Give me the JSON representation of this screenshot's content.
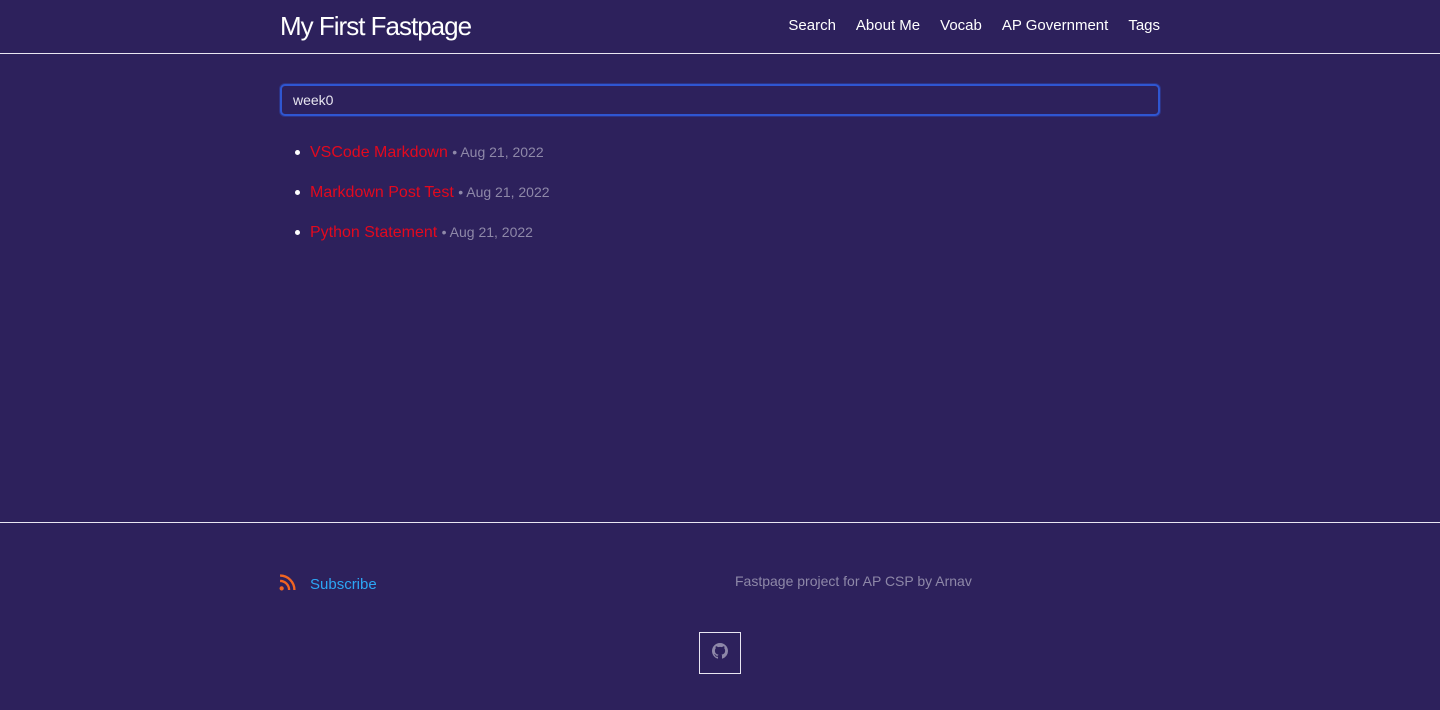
{
  "header": {
    "site_title": "My First Fastpage",
    "nav": [
      {
        "label": "Search"
      },
      {
        "label": "About Me"
      },
      {
        "label": "Vocab"
      },
      {
        "label": "AP Government"
      },
      {
        "label": "Tags"
      }
    ]
  },
  "search": {
    "value": "week0"
  },
  "results": [
    {
      "title": "VSCode Markdown",
      "date": "• Aug 21, 2022"
    },
    {
      "title": "Markdown Post Test",
      "date": "• Aug 21, 2022"
    },
    {
      "title": "Python Statement",
      "date": "• Aug 21, 2022"
    }
  ],
  "footer": {
    "subscribe_label": "Subscribe",
    "description": "Fastpage project for AP CSP by Arnav",
    "rss_icon": "rss-icon",
    "github_icon": "github-icon"
  },
  "colors": {
    "background": "#2d215c",
    "link_red": "#e3091e",
    "subscribe_blue": "#2ca6f5",
    "rss_orange": "#f26522",
    "muted_text": "#8e88a8"
  }
}
